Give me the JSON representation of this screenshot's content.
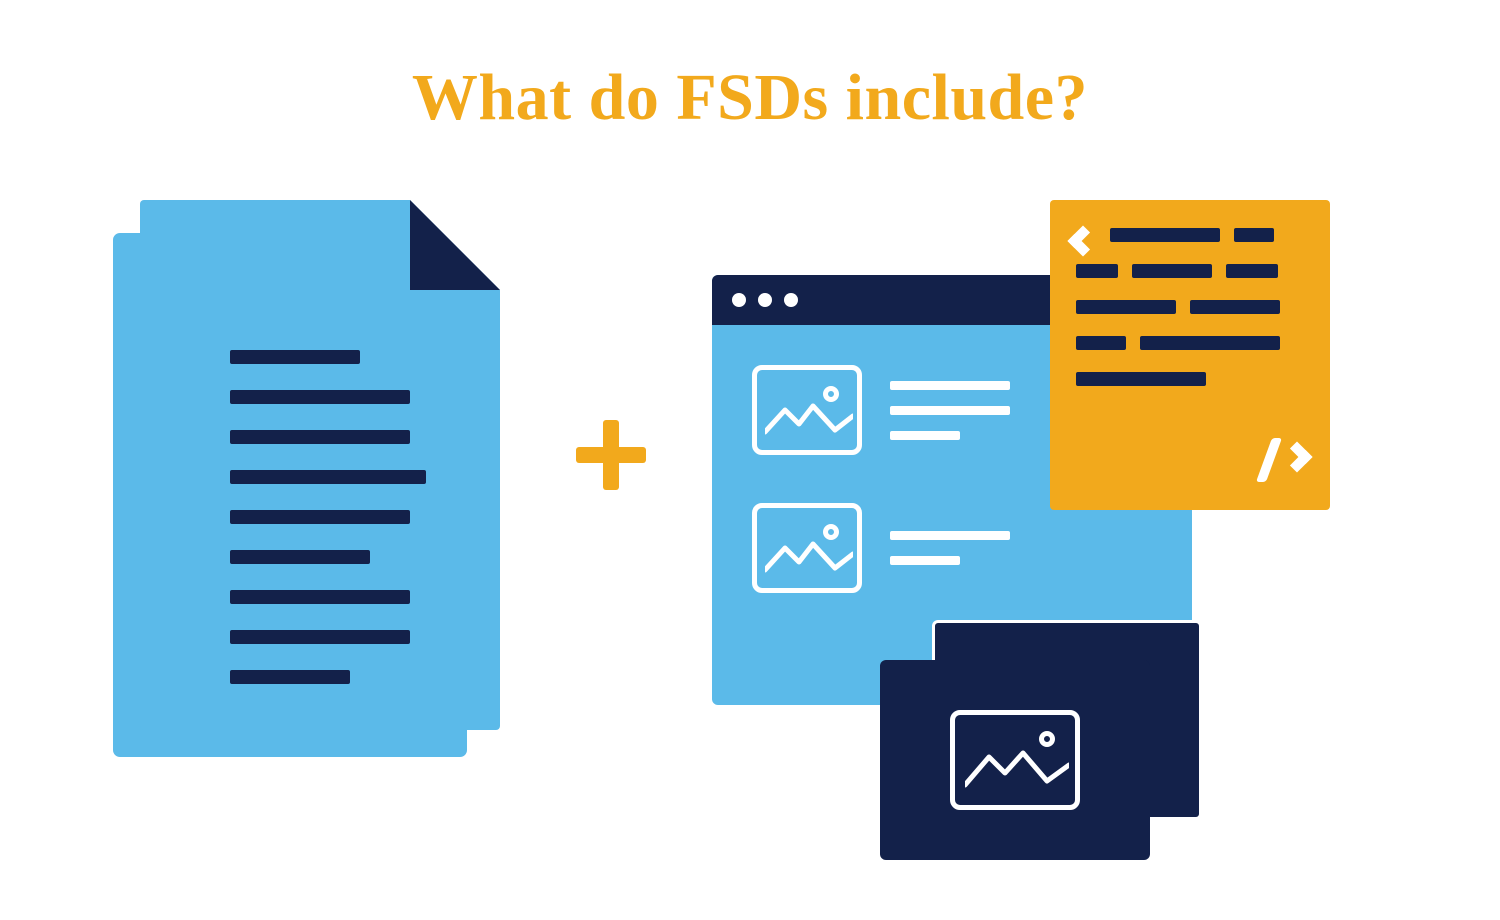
{
  "title": "What do FSDs include?",
  "colors": {
    "accent_gold": "#F2A91C",
    "sky_blue": "#5BBAE9",
    "navy": "#13214A",
    "white": "#ffffff"
  },
  "illustration": {
    "left_group": "text-documents",
    "connector": "plus",
    "right_group": [
      "browser-mockup",
      "code-snippet",
      "image-cards"
    ]
  }
}
